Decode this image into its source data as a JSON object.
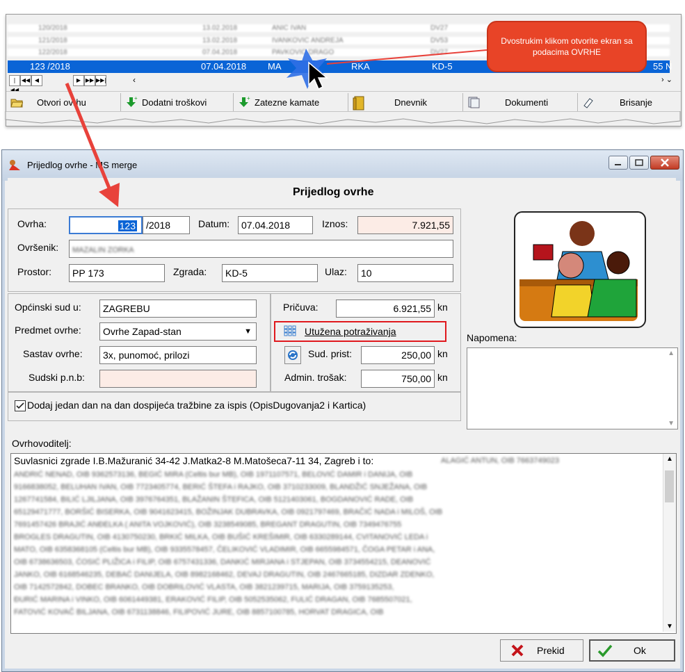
{
  "grid": {
    "blurred_rows": [
      {
        "id": "120/2018",
        "date": "13.02.2018",
        "name": "ANIC IVAN",
        "code": "DV27"
      },
      {
        "id": "121/2018",
        "date": "13.02.2018",
        "name": "IVANKOVIC ANDREJA",
        "code": "DV53"
      },
      {
        "id": "122/2018",
        "date": "07.04.2018",
        "name": "PAVKOVIC DRAGO",
        "code": "DV27"
      }
    ],
    "selected_row": {
      "id": "123 /2018",
      "date": "07.04.2018",
      "name": "MA",
      "name_tail": "RKA",
      "code": "KD-5",
      "amount": "55",
      "flag": "N"
    },
    "nav_buttons": [
      "|◀◀",
      "◀◀",
      "◀",
      "▶",
      "▶▶",
      "▶▶|"
    ],
    "toolbar": {
      "open_label": "Otvori ovrhu",
      "extra_costs_label": "Dodatni troškovi",
      "interest_label": "Zatezne kamate",
      "journal_label": "Dnevnik",
      "documents_label": "Dokumenti",
      "delete_label": "Brisanje"
    },
    "callout": "Dvostrukim klikom otvorite ekran sa podacima OVRHE"
  },
  "dialog": {
    "title": "Prijedlog ovrhe - MS merge",
    "heading": "Prijedlog ovrhe",
    "ovrha_label": "Ovrha:",
    "ovrha_number": "123",
    "ovrha_year": "/2018",
    "datum_label": "Datum:",
    "datum_value": "07.04.2018",
    "iznos_label": "Iznos:",
    "iznos_value": "7.921,55",
    "ovrsenik_label": "Ovršenik:",
    "ovrsenik_value": "MAZALIN ZORKA",
    "prostor_label": "Prostor:",
    "prostor_value": "PP 173",
    "zgrada_label": "Zgrada:",
    "zgrada_value": "KD-5",
    "ulaz_label": "Ulaz:",
    "ulaz_value": "10",
    "sud_label": "Općinski sud u:",
    "sud_value": "ZAGREBU",
    "predmet_label": "Predmet ovrhe:",
    "predmet_value": "Ovrhe Zapad-stan",
    "sastav_label": "Sastav ovrhe:",
    "sastav_value": "3x, punomoć, prilozi",
    "pnb_label": "Sudski p.n.b:",
    "pnb_value": "",
    "pricuva_label": "Pričuva:",
    "pricuva_value": "6.921,55",
    "utuzena_label": "Utužena potraživanja",
    "sud_prist_label": "Sud. prist:",
    "sud_prist_value": "250,00",
    "admin_label": "Admin. trošak:",
    "admin_value": "750,00",
    "currency": "kn",
    "checkbox_label": "Dodaj jedan dan na dan dospijeća tražbine za ispis (OpisDugovanja2 i Kartica)",
    "napomena_label": "Napomena:",
    "ovrhovoditelj_label": "Ovrhovoditelj:",
    "ovrhovoditelj_first": "Suvlasnici zgrade I.B.Mažuranić 34-42 J.Matka2-8 M.Matošeca7-11 34, Zagreb i to:",
    "ovrhovoditelj_blurred": [
      "ALAGIĆ ANTUN, OIB 7663749023",
      "ANDRIĆ NENAD, OIB 9362573136, BEGIĆ MIRA (Celtis bur MB), OIB 1971107571, BELOVIĆ DAMIR i DANIJA, OIB",
      "9166838052, BELUHAN IVAN, OIB 7723405774, BERIĆ ŠTEFA i RAJKO, OIB 3710233009, BLANDŽIĆ SNJEŽANA, OIB",
      "1267741584, BILIĆ LJILJANA, OIB 3976764351, BLAŽANIN ŠTEFICA, OIB 5121403061, BOGDANOVIĆ RADE, OIB",
      "65129471777, BORŠIĆ BISERKA, OIB 9041623415, BOŽINJAK DUBRAVKA, OIB 0921797469, BRAČIĆ NADA i MILOŠ, OIB",
      "7691457426 BRAJIĆ ANĐELKA ( ANITA VOJKOVIĆ), OIB 3238549085, BREGANT DRAGUTIN, OIB 7349476755",
      "BROGLES DRAGUTIN, OIB 4130750230, BRKIĆ MILKA, OIB BUŠIĆ KREŠIMIR, OIB 6330289144, CVITANOVIĆ LEDA i",
      "MATO, OIB 6358368105 (Celtis bur MB), OIB 9335578457, ČELIKOVIĆ VLADIMIR, OIB 6655984571, ČOGA PETAR i ANA,",
      "OIB 6738636503, ĆOSIĆ PLIŽICA i FILIP, OIB 6757431336, DANKIĆ MIRJANA i STJEPAN, OIB 3734554215, DEANOVIĆ",
      "JANKO, OIB 6168546235, DEBAĆ DANIJELA, OIB 8982168462, DEVAJ DRAGUTIN, OIB 2467665185, DIZDAR ZDENKO,",
      "OIB 7142572842, DOBEC BRANKO, OIB DOBRILOVIĆ VLASTA, OIB 3821239715, MARIJA, OIB 3759135253,",
      "ĐURIĆ MARINA i VINKO, OIB 6061449381, ERAKOVIĆ FILIP, OIB 5052535062, FULIĆ DRAGAN, OIB 7685507021,",
      "FATOVIĆ KOVAČ BILJANA, OIB 6731138846, FILIPOVIĆ JURE, OIB 8857100785, HORVAT DRAGICA, OIB"
    ],
    "cancel_label": "Prekid",
    "ok_label": "Ok"
  },
  "colors": {
    "selection": "#0a64d6",
    "callout": "#e84427",
    "highlight_border": "#e0181d",
    "arrow": "#e8423b"
  }
}
